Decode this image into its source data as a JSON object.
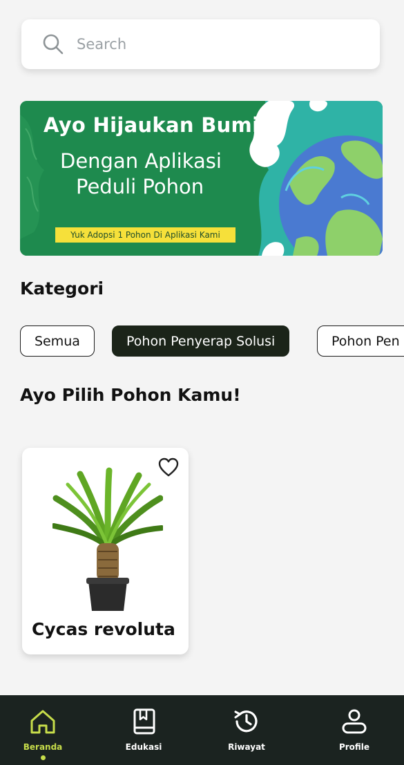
{
  "search": {
    "placeholder": "Search",
    "icon": "search-icon"
  },
  "banner": {
    "line1": "Ayo Hijaukan Bumi",
    "line2": "Dengan Aplikasi",
    "line3": "Peduli Pohon",
    "tagline": "Yuk Adopsi 1 Pohon Di Aplikasi Kami",
    "colors": {
      "background": "#1e8a4e",
      "tagline_bg": "#f6e03a"
    }
  },
  "categories": {
    "title": "Kategori",
    "items": [
      {
        "label": "Semua",
        "active": false
      },
      {
        "label": "Pohon Penyerap Solusi",
        "active": true
      },
      {
        "label": "Pohon Pen",
        "active": false
      }
    ]
  },
  "trees": {
    "title": "Ayo Pilih Pohon Kamu!",
    "items": [
      {
        "name": "Cycas revoluta",
        "icon": "heart-icon"
      }
    ]
  },
  "nav": {
    "active_color": "#c7dd4a",
    "items": [
      {
        "label": "Beranda",
        "icon": "home-icon",
        "active": true
      },
      {
        "label": "Edukasi",
        "icon": "book-icon",
        "active": false
      },
      {
        "label": "Riwayat",
        "icon": "history-icon",
        "active": false
      },
      {
        "label": "Profile",
        "icon": "user-icon",
        "active": false
      }
    ]
  }
}
